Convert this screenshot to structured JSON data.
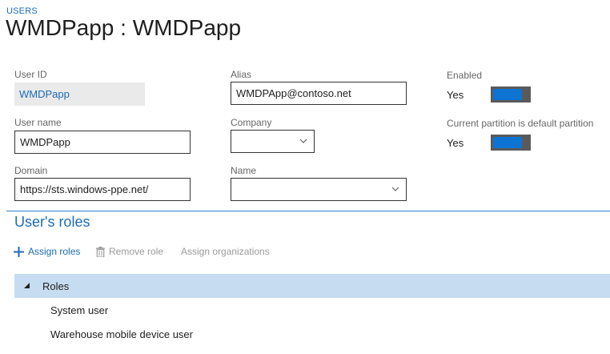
{
  "header": {
    "breadcrumb": "USERS",
    "title": "WMDPapp : WMDPapp"
  },
  "form": {
    "user_id": {
      "label": "User ID",
      "value": "WMDPapp"
    },
    "user_name": {
      "label": "User name",
      "value": "WMDPapp"
    },
    "domain": {
      "label": "Domain",
      "value": "https://sts.windows-ppe.net/"
    },
    "alias": {
      "label": "Alias",
      "value": "WMDPApp@contoso.net"
    },
    "company": {
      "label": "Company",
      "value": ""
    },
    "name": {
      "label": "Name",
      "value": ""
    },
    "enabled": {
      "label": "Enabled",
      "value": "Yes",
      "on": true
    },
    "default_partition": {
      "label": "Current partition is default partition",
      "value": "Yes",
      "on": true
    }
  },
  "roles_section": {
    "title": "User's roles",
    "actions": [
      {
        "label": "Assign roles",
        "icon": "plus-icon",
        "enabled": true
      },
      {
        "label": "Remove role",
        "icon": "trash-icon",
        "enabled": false
      },
      {
        "label": "Assign organizations",
        "icon": "",
        "enabled": false
      }
    ],
    "tree": {
      "group_label": "Roles",
      "expanded": true,
      "items": [
        "System user",
        "Warehouse mobile device user"
      ]
    }
  },
  "colors": {
    "accent": "#1c6bb8",
    "toggle_on": "#0e74d4",
    "selected_row": "#c6dcf0"
  }
}
